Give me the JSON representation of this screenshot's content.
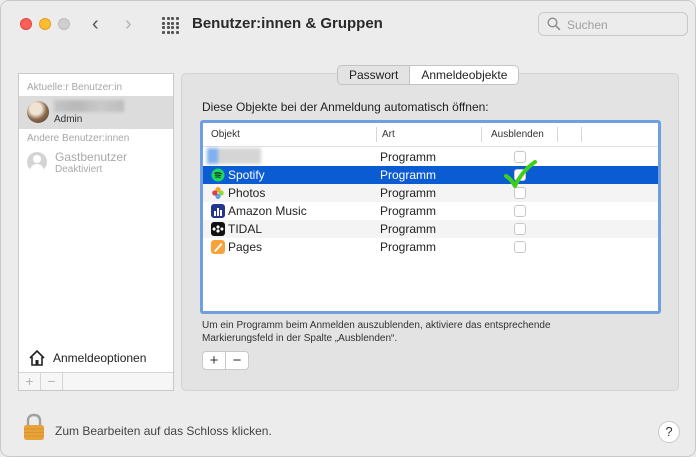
{
  "window": {
    "title": "Benutzer:innen & Gruppen"
  },
  "search": {
    "placeholder": "Suchen"
  },
  "sidebar": {
    "current_section": "Aktuelle:r Benutzer:in",
    "current_user_role": "Admin",
    "other_section": "Andere Benutzer:innen",
    "guest_name": "Gastbenutzer",
    "guest_status": "Deaktiviert",
    "login_options": "Anmeldeoptionen",
    "add_label": "+",
    "remove_label": "−"
  },
  "tabs": [
    {
      "label": "Passwort",
      "active": false
    },
    {
      "label": "Anmeldeobjekte",
      "active": true
    }
  ],
  "instruction": "Diese Objekte bei der Anmeldung automatisch öffnen:",
  "table": {
    "headers": [
      "Objekt",
      "Art",
      "Ausblenden"
    ],
    "rows": [
      {
        "name": "",
        "art": "Programm",
        "icon": "blurred-app-icon",
        "hidden": false
      },
      {
        "name": "Spotify",
        "art": "Programm",
        "icon": "spotify-icon",
        "hidden": true,
        "selected": true
      },
      {
        "name": "Photos",
        "art": "Programm",
        "icon": "photos-icon",
        "hidden": false
      },
      {
        "name": "Amazon Music",
        "art": "Programm",
        "icon": "amazon-music-icon",
        "hidden": false
      },
      {
        "name": "TIDAL",
        "art": "Programm",
        "icon": "tidal-icon",
        "hidden": false
      },
      {
        "name": "Pages",
        "art": "Programm",
        "icon": "pages-icon",
        "hidden": false
      }
    ]
  },
  "hint": "Um ein Programm beim Anmelden auszublenden, aktiviere das entsprechende Markierungsfeld in der Spalte „Ausblenden“.",
  "add_remove": {
    "add": "+",
    "remove": "−"
  },
  "footer": {
    "lock_text": "Zum Bearbeiten auf das Schloss klicken.",
    "help": "?"
  },
  "colors": {
    "selection": "#0b5bd3",
    "table_focus": "#6f9fe0",
    "checkmark": "#3ecf1c"
  }
}
